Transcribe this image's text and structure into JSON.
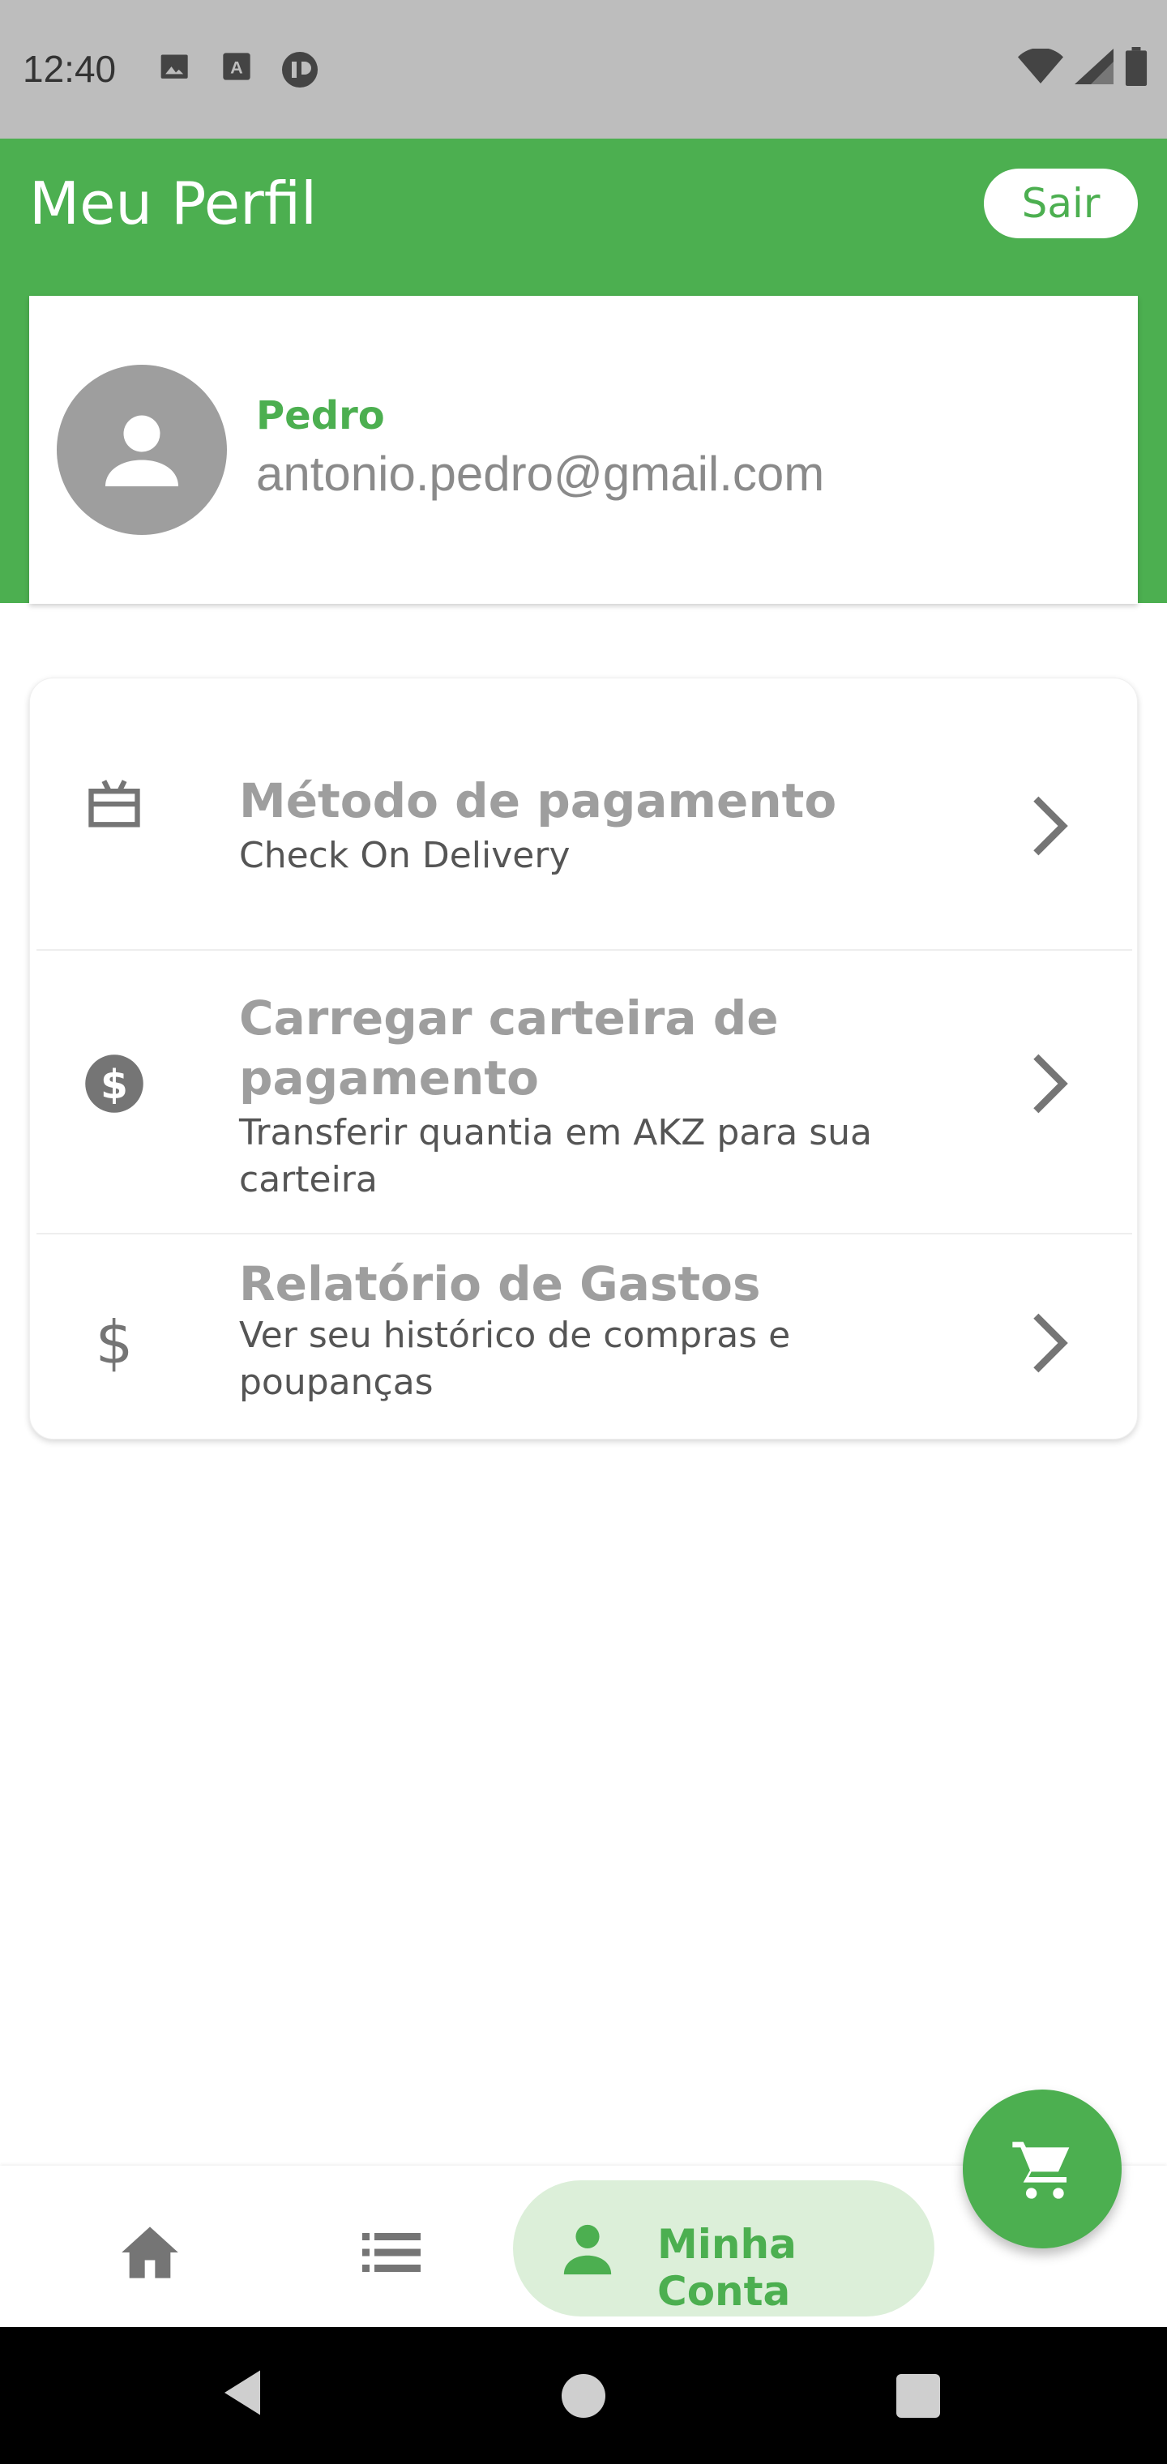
{
  "status_bar": {
    "time": "12:40"
  },
  "header": {
    "title": "Meu Perfil",
    "logout_label": "Sair",
    "color": "#4caf50"
  },
  "profile": {
    "name": "Pedro",
    "email": "antonio.pedro@gmail.com",
    "avatar_icon": "person-icon"
  },
  "options": [
    {
      "icon": "payment-card-icon",
      "title": "Método de pagamento",
      "subtitle": "Check On Delivery"
    },
    {
      "icon": "dollar-circle-icon",
      "title": "Carregar carteira de pagamento",
      "subtitle": "Transferir quantia em AKZ para sua carteira"
    },
    {
      "icon": "dollar-icon",
      "title": "Relatório de Gastos",
      "subtitle": "Ver seu histórico de compras e poupanças"
    }
  ],
  "bottom_nav": {
    "items": [
      {
        "icon": "home-icon"
      },
      {
        "icon": "list-icon"
      },
      {
        "icon": "person-icon",
        "label": "Minha Conta",
        "active": true
      }
    ]
  },
  "fab": {
    "icon": "cart-icon"
  }
}
